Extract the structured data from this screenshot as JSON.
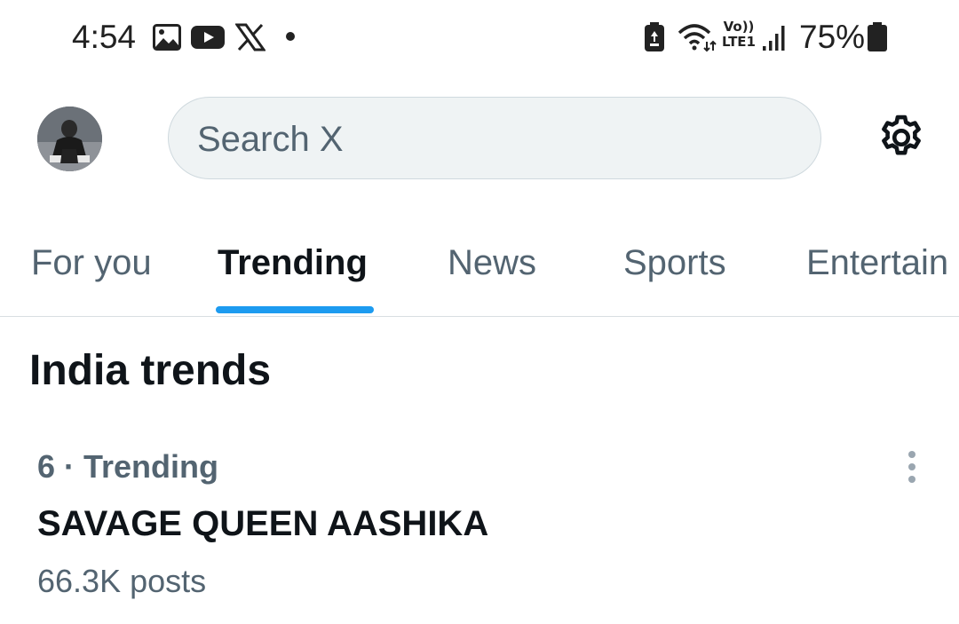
{
  "status_bar": {
    "time": "4:54",
    "battery_percent": "75%",
    "notification_icons": [
      "gallery-icon",
      "youtube-icon",
      "x-icon",
      "dot-icon"
    ],
    "system_icons": [
      "battery-saver-icon",
      "wifi-icon",
      "volte-icon",
      "signal-icon",
      "battery-icon"
    ],
    "volte_line1": "Vo))",
    "volte_line2": "LTE1"
  },
  "header": {
    "search": {
      "placeholder": "Search X"
    },
    "settings_icon": "gear-icon"
  },
  "tabs": [
    {
      "label": "For you",
      "active": false
    },
    {
      "label": "Trending",
      "active": true
    },
    {
      "label": "News",
      "active": false
    },
    {
      "label": "Sports",
      "active": false
    },
    {
      "label": "Entertain",
      "active": false
    }
  ],
  "section": {
    "title": "India trends"
  },
  "trend": {
    "meta": "6 · Trending",
    "name": "SAVAGE QUEEN AASHIKA",
    "posts": "66.3K posts"
  },
  "colors": {
    "accent": "#1d9bf0",
    "secondary_text": "#536471",
    "primary_text": "#0f1419",
    "search_bg": "#eff3f4"
  }
}
